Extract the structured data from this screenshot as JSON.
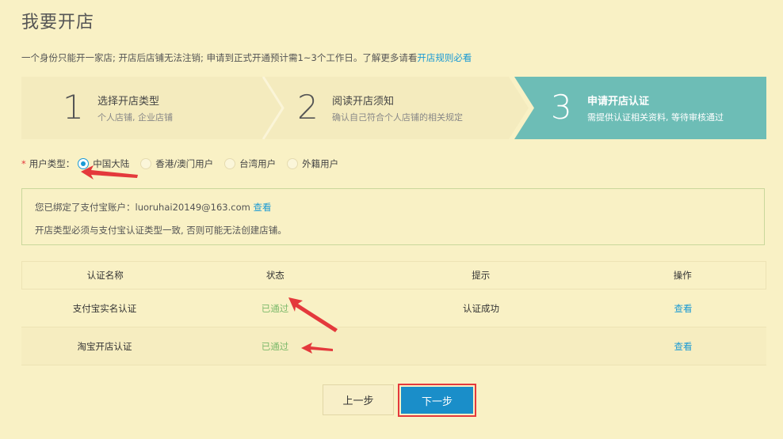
{
  "page": {
    "title": "我要开店",
    "notice_text": "一个身份只能开一家店; 开店后店铺无法注销; 申请到正式开通预计需1~3个工作日。了解更多请看",
    "notice_link": "开店规则必看"
  },
  "steps": [
    {
      "num": "1",
      "title": "选择开店类型",
      "desc": "个人店铺, 企业店铺"
    },
    {
      "num": "2",
      "title": "阅读开店须知",
      "desc": "确认自己符合个人店铺的相关规定"
    },
    {
      "num": "3",
      "title": "申请开店认证",
      "desc": "需提供认证相关资料, 等待审核通过"
    }
  ],
  "user_type": {
    "required_mark": "*",
    "label": "用户类型：",
    "options": [
      "中国大陆",
      "香港/澳门用户",
      "台湾用户",
      "外籍用户"
    ],
    "selected": "中国大陆"
  },
  "info": {
    "line1_prefix": "您已绑定了支付宝账户：luoruhai20149@163.com",
    "line1_link": "查看",
    "line2": "开店类型必须与支付宝认证类型一致, 否则可能无法创建店铺。"
  },
  "table": {
    "headers": [
      "认证名称",
      "状态",
      "提示",
      "操作"
    ],
    "rows": [
      {
        "name": "支付宝实名认证",
        "status": "已通过",
        "hint": "认证成功",
        "action": "查看"
      },
      {
        "name": "淘宝开店认证",
        "status": "已通过",
        "hint": "",
        "action": "查看"
      }
    ]
  },
  "buttons": {
    "prev": "上一步",
    "next": "下一步"
  },
  "colors": {
    "background": "#f9f1c5",
    "active_step": "#6dbdb6",
    "link": "#1a9ad4",
    "status_ok": "#7cb96a",
    "annotation": "#e4393c"
  }
}
